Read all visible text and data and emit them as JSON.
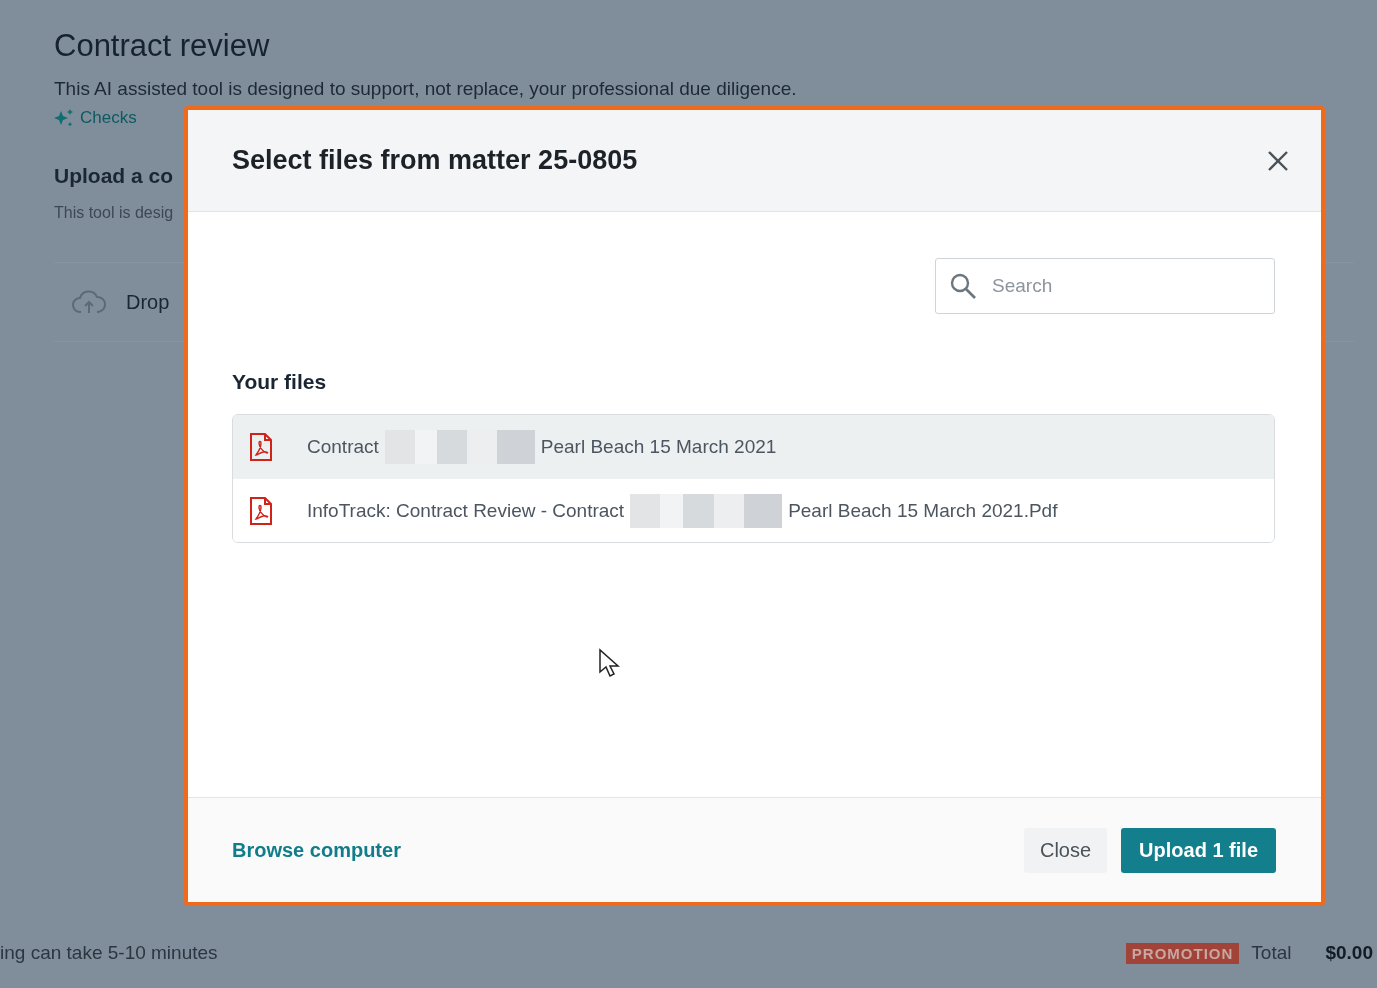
{
  "page": {
    "title": "Contract review",
    "intro": "This AI assisted tool is designed to support, not replace, your professional due diligence.",
    "checks_link": "Checks",
    "upload_heading": "Upload a co",
    "upload_note": "This tool is desig",
    "drop_label": "Drop",
    "processing_note": "ing can take 5-10 minutes",
    "promotion_badge": "PROMOTION",
    "total_label": "Total",
    "total_value": "$0.00"
  },
  "dialog": {
    "title": "Select files from matter 25-0805",
    "search": {
      "placeholder": "Search"
    },
    "section_title": "Your files",
    "files": [
      {
        "name_start": "Contract",
        "name_end": "Pearl Beach 15 March 2021",
        "redacted": true,
        "selected": true
      },
      {
        "name_start": "InfoTrack: Contract Review - Contract",
        "name_end": "Pearl Beach 15 March 2021.Pdf",
        "redacted": true,
        "selected": false
      }
    ],
    "browse_link": "Browse computer",
    "close_button": "Close",
    "upload_button": "Upload 1 file"
  }
}
